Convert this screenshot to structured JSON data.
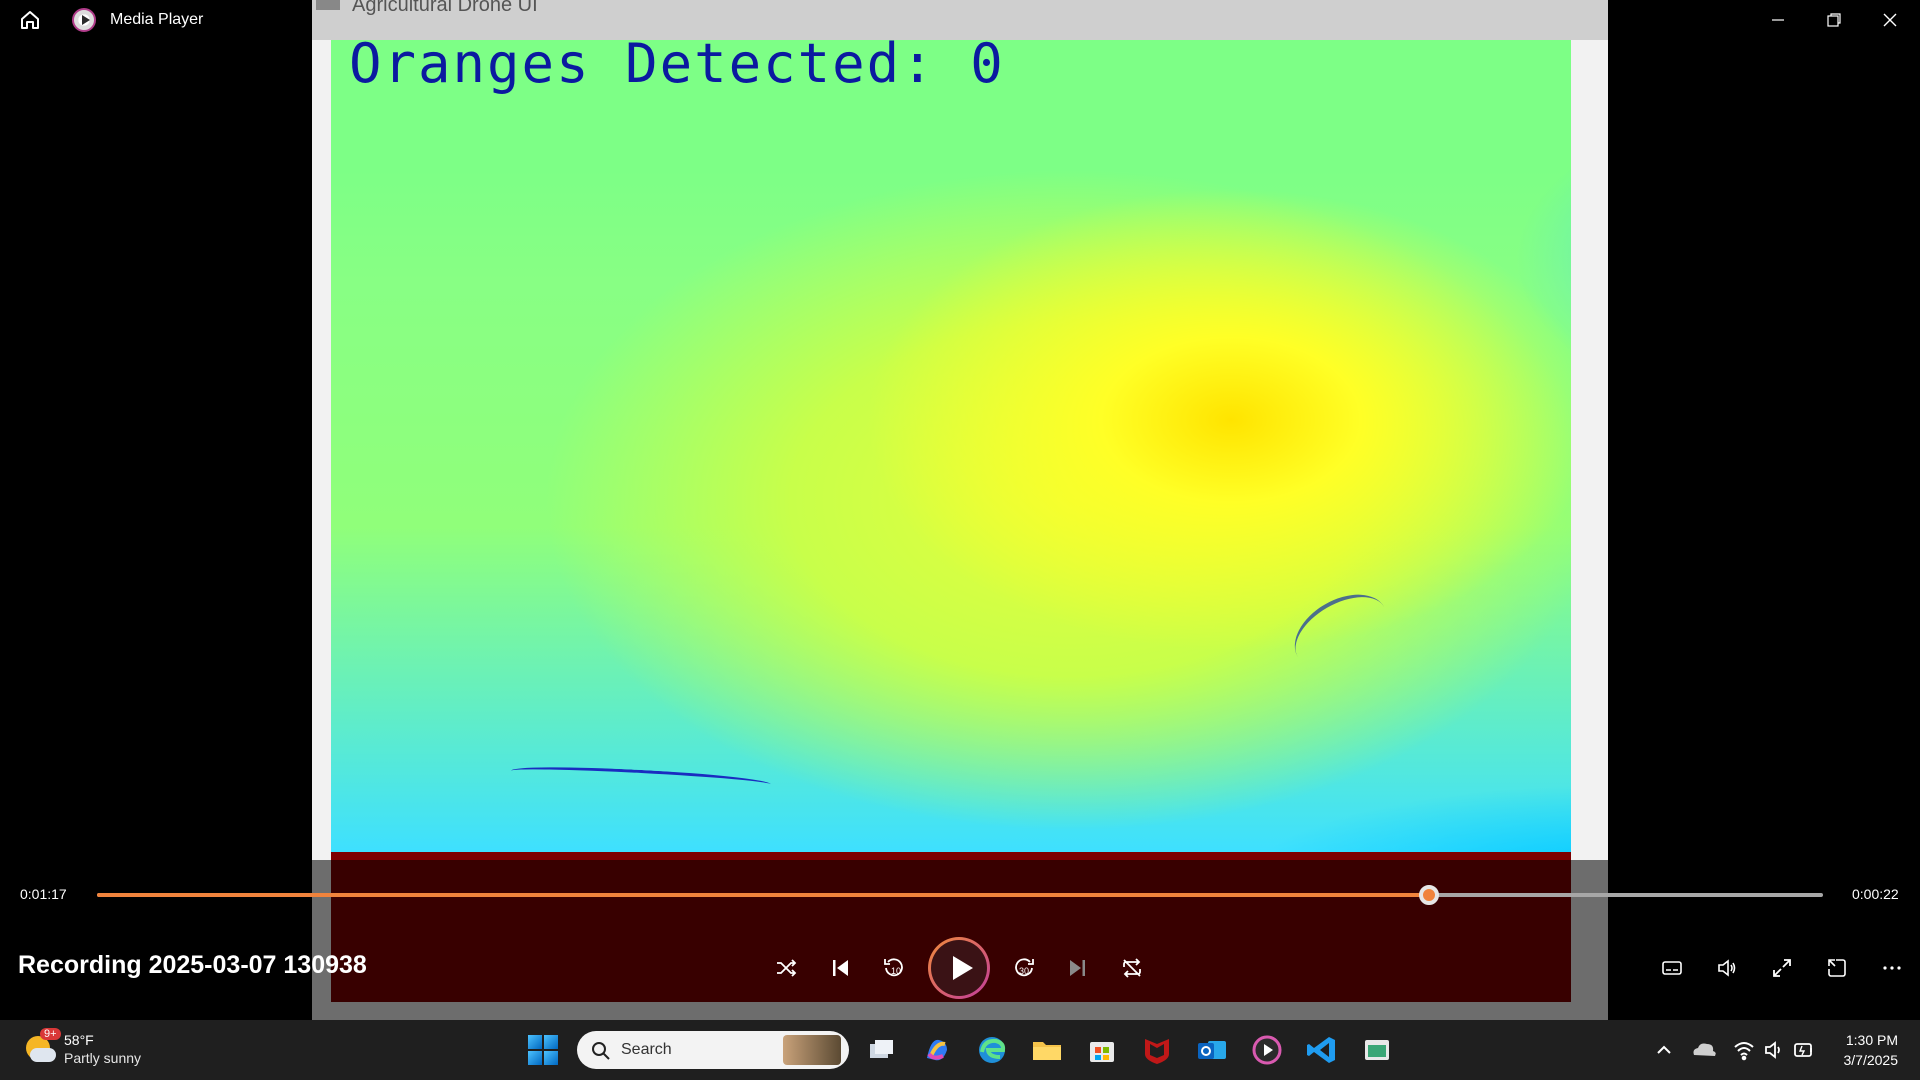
{
  "window": {
    "app_title": "Media Player",
    "background_window_title": "Agricultural Drone UI"
  },
  "video": {
    "overlay_text": "Oranges Detected: 0"
  },
  "player": {
    "elapsed": "0:01:17",
    "remaining": "0:00:22",
    "progress_fraction": 0.772,
    "recording_title": "Recording 2025-03-07 130938",
    "accent": "#f0833c",
    "controls": [
      "shuffle-icon",
      "previous-icon",
      "rewind-10-icon",
      "play-icon",
      "forward-30-icon",
      "next-icon",
      "repeat-icon"
    ],
    "right_controls": [
      "captions-icon",
      "volume-icon",
      "fullscreen-icon",
      "miniplayer-icon",
      "more-icon"
    ],
    "rewind_label": "10",
    "forward_label": "30"
  },
  "taskbar": {
    "weather_badge": "9+",
    "weather_temp": "58°F",
    "weather_desc": "Partly sunny",
    "search_placeholder": "Search",
    "clock_time": "1:30 PM",
    "clock_date": "3/7/2025",
    "apps": [
      "task-view-icon",
      "copilot-icon",
      "edge-icon",
      "file-explorer-icon",
      "microsoft-store-icon",
      "mcafee-icon",
      "outlook-icon",
      "media-player-icon",
      "vscode-icon",
      "app-window-icon"
    ]
  }
}
